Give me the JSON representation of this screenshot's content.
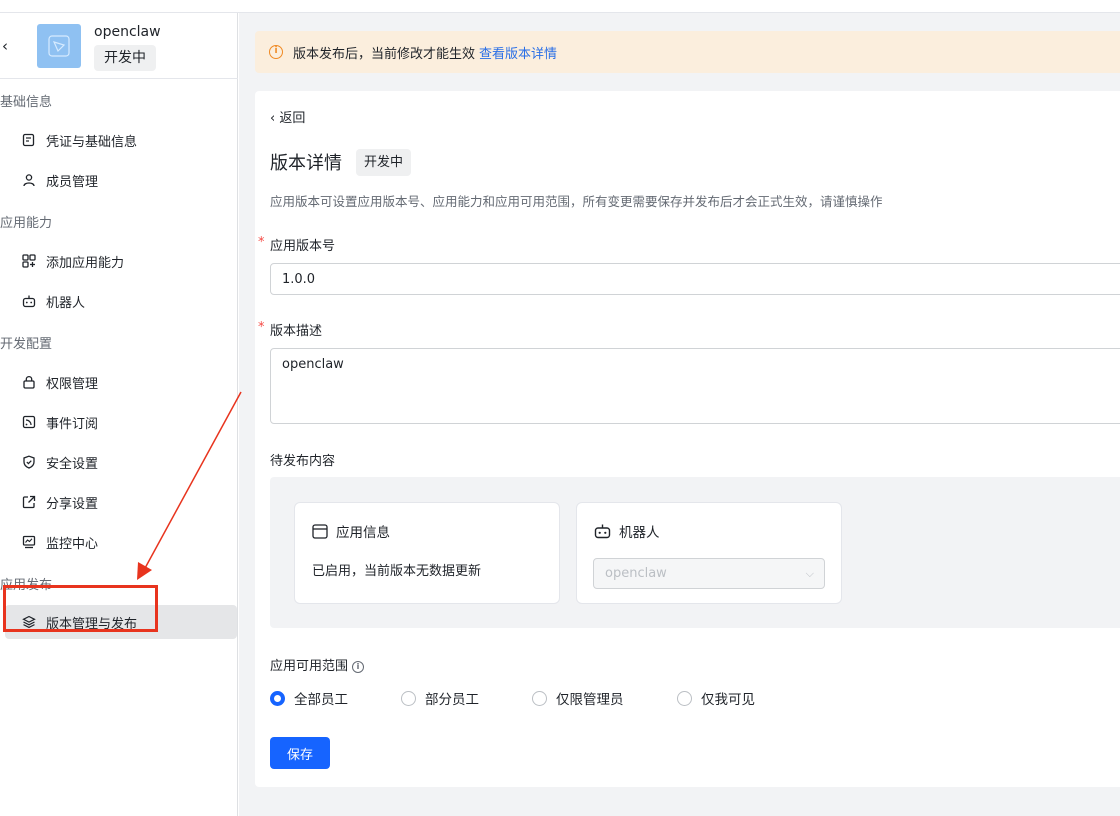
{
  "app": {
    "name": "openclaw",
    "status": "开发中"
  },
  "sidebar": {
    "groups": [
      {
        "title": "基础信息",
        "items": [
          {
            "label": "凭证与基础信息"
          },
          {
            "label": "成员管理"
          }
        ]
      },
      {
        "title": "应用能力",
        "items": [
          {
            "label": "添加应用能力"
          },
          {
            "label": "机器人"
          }
        ]
      },
      {
        "title": "开发配置",
        "items": [
          {
            "label": "权限管理"
          },
          {
            "label": "事件订阅"
          },
          {
            "label": "安全设置"
          },
          {
            "label": "分享设置"
          },
          {
            "label": "监控中心"
          }
        ]
      },
      {
        "title": "应用发布",
        "items": [
          {
            "label": "版本管理与发布",
            "active": true
          }
        ]
      }
    ]
  },
  "notice": {
    "text": "版本发布后，当前修改才能生效",
    "link": "查看版本详情"
  },
  "detail": {
    "back": "返回",
    "title": "版本详情",
    "status": "开发中",
    "description": "应用版本可设置应用版本号、应用能力和应用可用范围，所有变更需要保存并发布后才会正式生效，请谨慎操作",
    "version_label": "应用版本号",
    "version_value": "1.0.0",
    "desc_label": "版本描述",
    "desc_value": "openclaw",
    "pending_label": "待发布内容",
    "pending": {
      "app_info": {
        "title": "应用信息",
        "text": "已启用，当前版本无数据更新"
      },
      "bot": {
        "title": "机器人",
        "select_value": "openclaw"
      }
    },
    "scope_label": "应用可用范围",
    "scope_options": [
      {
        "label": "全部员工",
        "selected": true
      },
      {
        "label": "部分员工",
        "selected": false
      },
      {
        "label": "仅限管理员",
        "selected": false
      },
      {
        "label": "仅我可见",
        "selected": false
      }
    ],
    "save": "保存"
  },
  "colors": {
    "primary": "#1664ff",
    "notice_bg": "#fbeedd",
    "annotation": "#e8341e"
  }
}
